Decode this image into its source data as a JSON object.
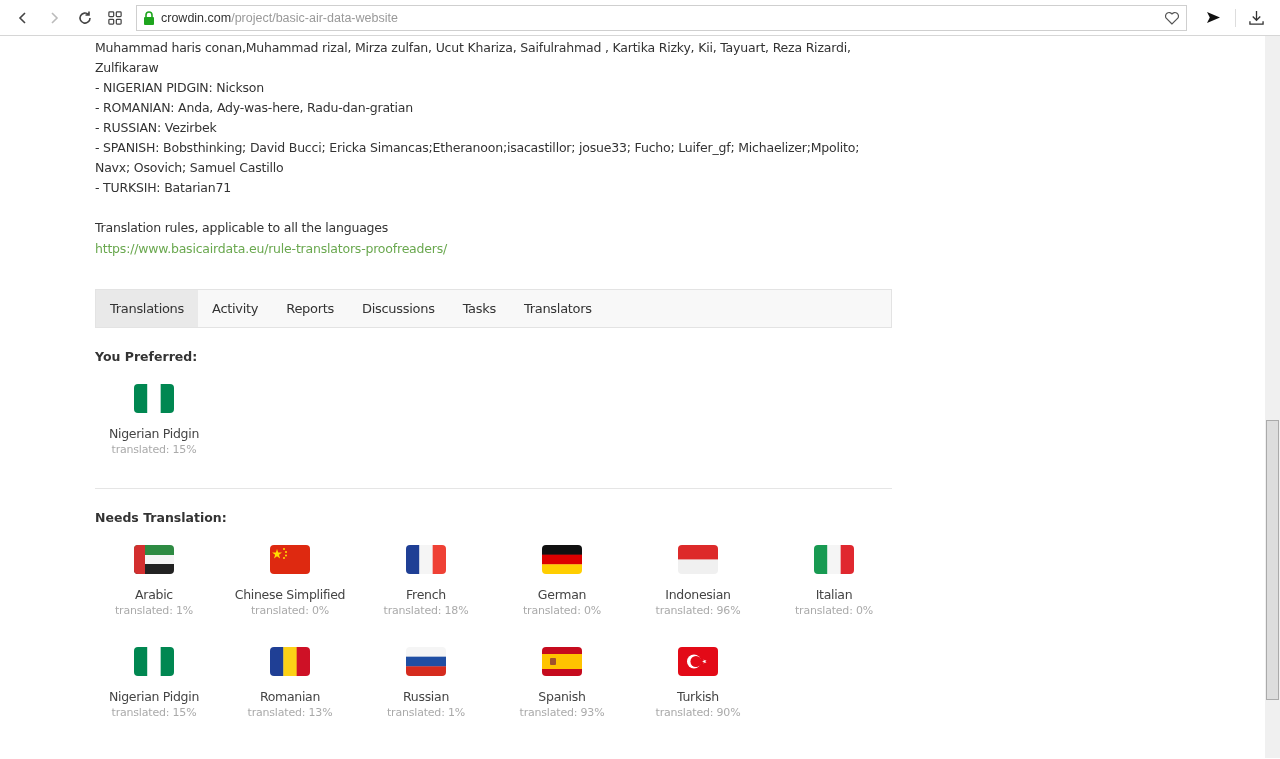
{
  "browser": {
    "url_host": "crowdin.com",
    "url_path": "/project/basic-air-data-website",
    "forward_disabled": true
  },
  "credits": [
    "Muhammad haris conan,Muhammad rizal, Mirza zulfan, Ucut Khariza, Saifulrahmad , Kartika Rizky, Kii, Tayuart, Reza Rizardi, Zulfikaraw",
    "- NIGERIAN PIDGIN: Nickson",
    "- ROMANIAN: Anda, Ady-was-here, Radu-dan-gratian",
    "- RUSSIAN: Vezirbek",
    "- SPANISH: Bobsthinking; David Bucci; Ericka Simancas;Etheranoon;isacastillor; josue33; Fucho; Luifer_gf; Michaelizer;Mpolito; Navx; Osovich; Samuel Castillo",
    "- TURKSIH: Batarian71"
  ],
  "rules_text": "Translation rules, applicable to all the languages",
  "rules_link": "https://www.basicairdata.eu/rule-translators-proofreaders/",
  "tabs": [
    {
      "label": "Translations",
      "selected": true
    },
    {
      "label": "Activity",
      "selected": false
    },
    {
      "label": "Reports",
      "selected": false
    },
    {
      "label": "Discussions",
      "selected": false
    },
    {
      "label": "Tasks",
      "selected": false
    },
    {
      "label": "Translators",
      "selected": false
    }
  ],
  "sections": [
    {
      "heading": "You Preferred:",
      "languages": [
        {
          "kind": "ng",
          "name": "Nigerian Pidgin",
          "progress": "translated: 15%"
        }
      ]
    },
    {
      "heading": "Needs Translation:",
      "languages": [
        {
          "kind": "ae",
          "name": "Arabic",
          "progress": "translated: 1%"
        },
        {
          "kind": "cn",
          "name": "Chinese Simplified",
          "progress": "translated: 0%"
        },
        {
          "kind": "fr",
          "name": "French",
          "progress": "translated: 18%"
        },
        {
          "kind": "de",
          "name": "German",
          "progress": "translated: 0%"
        },
        {
          "kind": "id",
          "name": "Indonesian",
          "progress": "translated: 96%"
        },
        {
          "kind": "it",
          "name": "Italian",
          "progress": "translated: 0%"
        },
        {
          "kind": "ng",
          "name": "Nigerian Pidgin",
          "progress": "translated: 15%"
        },
        {
          "kind": "ro",
          "name": "Romanian",
          "progress": "translated: 13%"
        },
        {
          "kind": "ru",
          "name": "Russian",
          "progress": "translated: 1%"
        },
        {
          "kind": "es",
          "name": "Spanish",
          "progress": "translated: 93%"
        },
        {
          "kind": "tr",
          "name": "Turkish",
          "progress": "translated: 90%"
        }
      ]
    }
  ]
}
